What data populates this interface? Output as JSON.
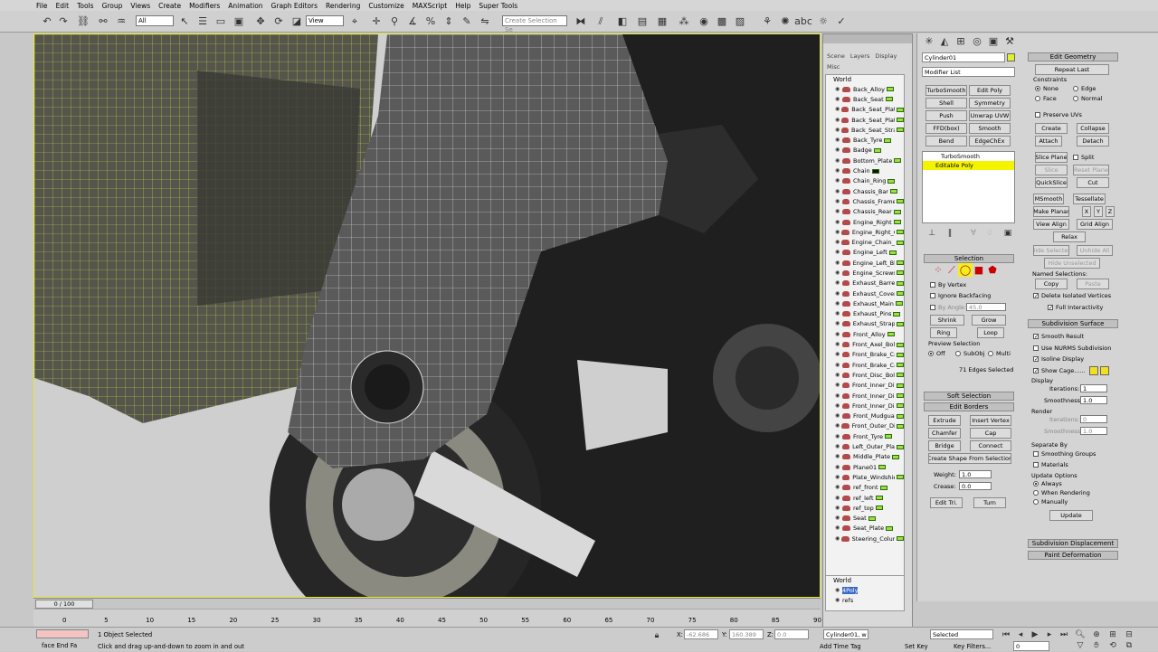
{
  "menu": [
    "File",
    "Edit",
    "Tools",
    "Group",
    "Views",
    "Create",
    "Modifiers",
    "Animation",
    "Graph Editors",
    "Rendering",
    "Customize",
    "MAXScript",
    "Help",
    "Super Tools"
  ],
  "toolbar": {
    "filter_value": "All",
    "refcoord_value": "View",
    "named_selection_placeholder": "Create Selection Se"
  },
  "scene_explorer": {
    "tabs": [
      "Scene",
      "Layers",
      "Display"
    ],
    "misc": "Misc",
    "root": "World",
    "items": [
      {
        "label": "Back_Alloy",
        "swatch": "#9ce03c"
      },
      {
        "label": "Back_Seat",
        "swatch": "#9ce03c"
      },
      {
        "label": "Back_Seat_Plate",
        "swatch": "#9ce03c"
      },
      {
        "label": "Back_Seat_Plate",
        "swatch": "#9ce03c"
      },
      {
        "label": "Back_Seat_Strap",
        "swatch": "#9ce03c"
      },
      {
        "label": "Back_Tyre",
        "swatch": "#9ce03c"
      },
      {
        "label": "Badge",
        "swatch": "#9ce03c"
      },
      {
        "label": "Bottom_Plate",
        "swatch": "#9ce03c"
      },
      {
        "label": "Chain",
        "swatch": "#111111"
      },
      {
        "label": "Chain_Ring",
        "swatch": "#9ce03c"
      },
      {
        "label": "Chassis_Bar",
        "swatch": "#9ce03c"
      },
      {
        "label": "Chassis_Frame",
        "swatch": "#9ce03c"
      },
      {
        "label": "Chassis_Rear",
        "swatch": "#9ce03c"
      },
      {
        "label": "Engine_Right",
        "swatch": "#9ce03c"
      },
      {
        "label": "Engine_Right_C",
        "swatch": "#9ce03c"
      },
      {
        "label": "Engine_Chain_C",
        "swatch": "#9ce03c"
      },
      {
        "label": "Engine_Left",
        "swatch": "#9ce03c"
      },
      {
        "label": "Engine_Left_Bl",
        "swatch": "#9ce03c"
      },
      {
        "label": "Engine_Screws",
        "swatch": "#9ce03c"
      },
      {
        "label": "Exhaust_Barrel",
        "swatch": "#9ce03c"
      },
      {
        "label": "Exhaust_Cover",
        "swatch": "#9ce03c"
      },
      {
        "label": "Exhaust_Main",
        "swatch": "#9ce03c"
      },
      {
        "label": "Exhaust_Pins",
        "swatch": "#9ce03c"
      },
      {
        "label": "Exhaust_Strap",
        "swatch": "#9ce03c"
      },
      {
        "label": "Front_Alloy",
        "swatch": "#9ce03c"
      },
      {
        "label": "Front_Axel_Bolt",
        "swatch": "#9ce03c"
      },
      {
        "label": "Front_Brake_Ca",
        "swatch": "#9ce03c"
      },
      {
        "label": "Front_Brake_Ca",
        "swatch": "#9ce03c"
      },
      {
        "label": "Front_Disc_Bolt",
        "swatch": "#9ce03c"
      },
      {
        "label": "Front_Inner_Dis",
        "swatch": "#9ce03c"
      },
      {
        "label": "Front_Inner_Dis",
        "swatch": "#9ce03c"
      },
      {
        "label": "Front_Inner_Dis",
        "swatch": "#9ce03c"
      },
      {
        "label": "Front_Mudgua",
        "swatch": "#9ce03c"
      },
      {
        "label": "Front_Outer_Dis",
        "swatch": "#9ce03c"
      },
      {
        "label": "Front_Tyre",
        "swatch": "#9ce03c"
      },
      {
        "label": "Left_Outer_Plat",
        "swatch": "#9ce03c"
      },
      {
        "label": "Middle_Plate",
        "swatch": "#9ce03c"
      },
      {
        "label": "Plane01",
        "swatch": "#9ce03c"
      },
      {
        "label": "Plate_Windshie",
        "swatch": "#9ce03c"
      },
      {
        "label": "ref_front",
        "swatch": "#9ce03c"
      },
      {
        "label": "ref_left",
        "swatch": "#9ce03c"
      },
      {
        "label": "ref_top",
        "swatch": "#9ce03c"
      },
      {
        "label": "Seat",
        "swatch": "#9ce03c"
      },
      {
        "label": "Seat_Plate",
        "swatch": "#9ce03c"
      },
      {
        "label": "Steering_Colum",
        "swatch": "#9ce03c"
      }
    ],
    "bottom_root": "World",
    "bottom_items": [
      "4Poly",
      "refs"
    ]
  },
  "command_panel": {
    "object_name": "Cylinder01",
    "modifier_list": "Modifier List",
    "modifier_buttons": [
      "TurboSmooth",
      "Edit Poly",
      "Shell",
      "Symmetry",
      "Push",
      "Unwrap UVW",
      "FFD(box)",
      "Smooth",
      "Bend",
      "EdgeChEx"
    ],
    "stack": [
      "TurboSmooth",
      "Editable Poly"
    ],
    "selection_title": "Selection",
    "by_vertex": "By Vertex",
    "ignore_backfacing": "Ignore Backfacing",
    "by_angle": "By Angle:",
    "angle_value": "45.0",
    "shrink": "Shrink",
    "grow": "Grow",
    "ring": "Ring",
    "loop": "Loop",
    "preview_selection": "Preview Selection",
    "preview_opts": [
      "Off",
      "SubObj",
      "Multi"
    ],
    "edges_selected": "71 Edges Selected",
    "soft_selection": "Soft Selection",
    "edit_borders": "Edit Borders",
    "extrude": "Extrude",
    "insert_vertex": "Insert Vertex",
    "chamfer": "Chamfer",
    "cap": "Cap",
    "bridge": "Bridge",
    "connect": "Connect",
    "create_shape": "Create Shape From Selection",
    "weight_label": "Weight:",
    "weight_value": "1.0",
    "crease_label": "Crease:",
    "crease_value": "0.0",
    "edit_tri": "Edit Tri.",
    "turn": "Turn",
    "edit_geometry": "Edit Geometry",
    "repeat_last": "Repeat Last",
    "constraints": "Constraints",
    "constraint_opts": [
      "None",
      "Edge",
      "Face",
      "Normal"
    ],
    "preserve_uvs": "Preserve UVs",
    "create": "Create",
    "collapse": "Collapse",
    "attach": "Attach",
    "detach": "Detach",
    "slice_plane": "Slice Plane",
    "split": "Split",
    "slice": "Slice",
    "reset_plane": "Reset Plane",
    "quickslice": "QuickSlice",
    "cut": "Cut",
    "msmooth": "MSmooth",
    "tessellate": "Tessellate",
    "make_planar": "Make Planar",
    "x": "X",
    "y": "Y",
    "z": "Z",
    "view_align": "View Align",
    "grid_align": "Grid Align",
    "relax": "Relax",
    "hide_selected": "Hide Selected",
    "unhide_all": "Unhide All",
    "hide_unselected": "Hide Unselected",
    "named_selections": "Named Selections:",
    "copy": "Copy",
    "paste": "Paste",
    "delete_isolated": "Delete Isolated Vertices",
    "full_interactivity": "Full Interactivity",
    "subdivision_surface": "Subdivision Surface",
    "smooth_result": "Smooth Result",
    "use_nurms": "Use NURMS Subdivision",
    "isoline_display": "Isoline Display",
    "show_cage": "Show Cage......",
    "display": "Display",
    "iterations": "Iterations:",
    "iter_value": "1",
    "smoothness": "Smoothness:",
    "smooth_value": "1.0",
    "render": "Render",
    "render_iter_value": "0",
    "render_smooth_value": "1.0",
    "separate_by": "Separate By",
    "smoothing_groups": "Smoothing Groups",
    "materials": "Materials",
    "update_options": "Update Options",
    "update_opts": [
      "Always",
      "When Rendering",
      "Manually"
    ],
    "update": "Update",
    "subdivision_displacement": "Subdivision Displacement",
    "paint_deformation": "Paint Deformation"
  },
  "timeline": {
    "frame": "0 / 100",
    "ticks": [
      "0",
      "5",
      "10",
      "15",
      "20",
      "25",
      "30",
      "35",
      "40",
      "45",
      "50",
      "55",
      "60",
      "65",
      "70",
      "75",
      "80",
      "85",
      "90"
    ]
  },
  "status": {
    "maxscript": "face End Fa",
    "selected": "1 Object Selected",
    "prompt": "Click and drag up-and-down to zoom in and out",
    "x_label": "X:",
    "x_value": "-62.686",
    "y_label": "Y:",
    "y_value": "160.389",
    "z_label": "Z:",
    "z_value": "0.0",
    "add_time_tag": "Add Time Tag",
    "obj_field": "Cylinder01, w",
    "set_key": "Set Key",
    "key_filters": "Key Filters...",
    "selected_dropdown": "Selected",
    "frame_field": "0"
  }
}
